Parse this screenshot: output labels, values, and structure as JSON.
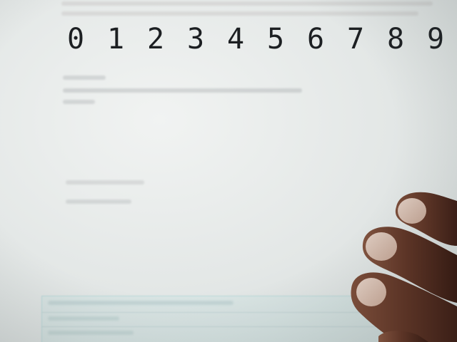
{
  "digits": [
    "0",
    "1",
    "2",
    "3",
    "4",
    "5",
    "6",
    "7",
    "8",
    "9"
  ]
}
